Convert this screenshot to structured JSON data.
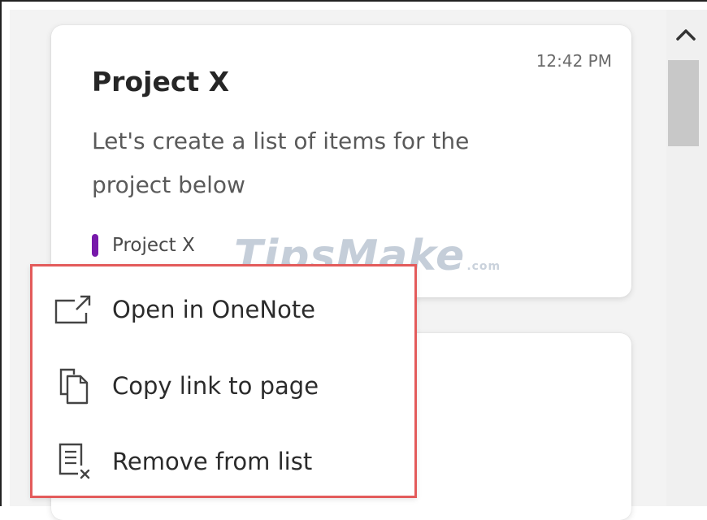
{
  "card": {
    "time": "12:42 PM",
    "title": "Project X",
    "snippet": "Let's create a list of items for the project below",
    "tag_label": "Project X",
    "tag_color": "#7719aa"
  },
  "watermark": {
    "text": "TipsMake",
    "suffix": ".com"
  },
  "context_menu": {
    "border_color": "#e35b5b",
    "items": [
      {
        "label": "Open in OneNote",
        "icon": "open-external-icon"
      },
      {
        "label": "Copy link to page",
        "icon": "copy-icon"
      },
      {
        "label": "Remove from list",
        "icon": "remove-list-icon"
      }
    ]
  },
  "scrollbar": {
    "up_icon": "chevron-up-icon"
  }
}
